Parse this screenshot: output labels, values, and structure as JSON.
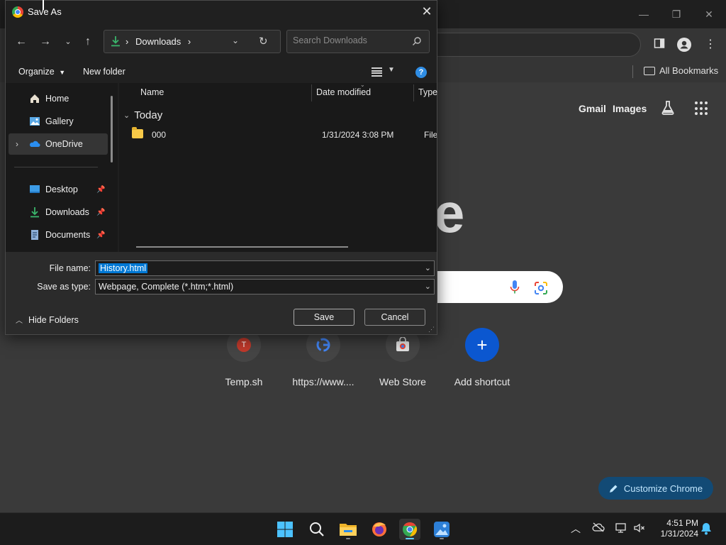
{
  "chrome": {
    "bookmarks": {
      "all_label": "All Bookmarks"
    },
    "ntp": {
      "gmail": "Gmail",
      "images": "Images",
      "logo_fragment": "e",
      "shortcuts": [
        {
          "label": "Temp.sh",
          "icon": "T"
        },
        {
          "label": "https://www....",
          "icon": "G"
        },
        {
          "label": "Web Store",
          "icon": "webstore"
        },
        {
          "label": "Add shortcut",
          "icon": "+"
        }
      ],
      "customize_label": "Customize Chrome"
    }
  },
  "dialog": {
    "title": "Save As",
    "address": {
      "location": "Downloads",
      "chevron": "›"
    },
    "search": {
      "placeholder": "Search Downloads"
    },
    "commands": {
      "organize": "Organize",
      "new_folder": "New folder"
    },
    "nav_items": [
      {
        "label": "Home"
      },
      {
        "label": "Gallery"
      },
      {
        "label": "OneDrive"
      },
      {
        "label": "Desktop"
      },
      {
        "label": "Downloads"
      },
      {
        "label": "Documents"
      }
    ],
    "columns": {
      "name": "Name",
      "date": "Date modified",
      "type": "Type"
    },
    "group": "Today",
    "files": [
      {
        "name": "000",
        "date": "1/31/2024 3:08 PM",
        "type": "File fo"
      }
    ],
    "file_name_label": "File name:",
    "file_name_value": "History.html",
    "save_type_label": "Save as type:",
    "save_type_value": "Webpage, Complete (*.htm;*.html)",
    "hide_folders": "Hide Folders",
    "save_button": "Save",
    "cancel_button": "Cancel"
  },
  "taskbar": {
    "time": "4:51 PM",
    "date": "1/31/2024"
  },
  "colors": {
    "accent": "#0078d4",
    "customize_bg": "#124a75",
    "add_shortcut": "#0b57d0"
  }
}
